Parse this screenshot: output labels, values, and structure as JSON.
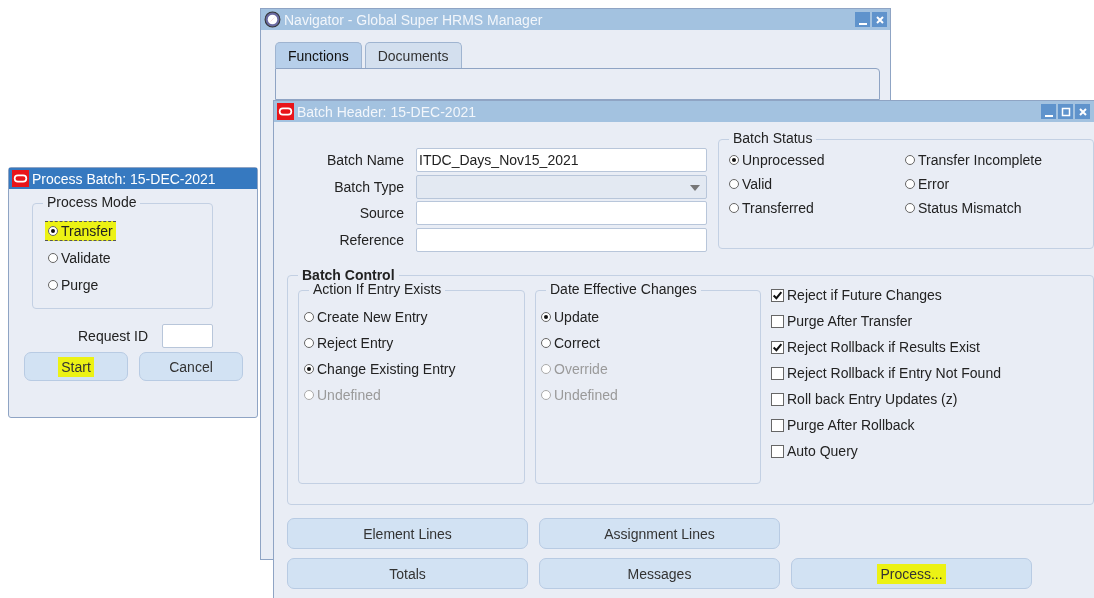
{
  "navigator": {
    "title": "Navigator - Global Super HRMS Manager",
    "tabs": [
      {
        "label": "Functions",
        "selected": true
      },
      {
        "label": "Documents",
        "selected": false
      }
    ]
  },
  "batch_header": {
    "title": "Batch Header: 15-DEC-2021",
    "fields": [
      {
        "label": "Batch Name",
        "kind": "text",
        "value": "ITDC_Days_Nov15_2021"
      },
      {
        "label": "Batch Type",
        "kind": "dropdown"
      },
      {
        "label": "Source",
        "kind": "text"
      },
      {
        "label": "Reference",
        "kind": "text"
      }
    ],
    "batch_status": {
      "label": "Batch Status",
      "options": [
        {
          "label": "Unprocessed",
          "selected": true
        },
        {
          "label": "Transfer Incomplete",
          "selected": false
        },
        {
          "label": "Valid",
          "selected": false
        },
        {
          "label": "Error",
          "selected": false
        },
        {
          "label": "Transferred",
          "selected": false
        },
        {
          "label": "Status Mismatch",
          "selected": false
        }
      ]
    },
    "batch_control": {
      "label": "Batch Control",
      "groups": [
        {
          "label": "Action If Entry Exists",
          "options": [
            {
              "label": "Create New Entry",
              "selected": false,
              "disabled": false
            },
            {
              "label": "Reject Entry",
              "selected": false,
              "disabled": false
            },
            {
              "label": "Change Existing Entry",
              "selected": true,
              "disabled": false
            },
            {
              "label": "Undefined",
              "selected": false,
              "disabled": true
            }
          ]
        },
        {
          "label": "Date Effective Changes",
          "options": [
            {
              "label": "Update",
              "selected": true,
              "disabled": false
            },
            {
              "label": "Correct",
              "selected": false,
              "disabled": false
            },
            {
              "label": "Override",
              "selected": false,
              "disabled": true
            },
            {
              "label": "Undefined",
              "selected": false,
              "disabled": true
            }
          ]
        }
      ],
      "checkboxes": [
        {
          "label": "Reject if Future Changes",
          "checked": true
        },
        {
          "label": "Purge After Transfer",
          "checked": false
        },
        {
          "label": "Reject Rollback if Results Exist",
          "checked": true
        },
        {
          "label": "Reject Rollback if Entry Not Found",
          "checked": false
        },
        {
          "label": "Roll back Entry Updates (z)",
          "checked": false
        },
        {
          "label": "Purge After Rollback",
          "checked": false
        },
        {
          "label": "Auto Query",
          "checked": false
        }
      ]
    },
    "button_rows": [
      [
        {
          "label": "Element Lines",
          "highlighted": false
        },
        {
          "label": "Assignment Lines",
          "highlighted": false
        }
      ],
      [
        {
          "label": "Totals",
          "highlighted": false
        },
        {
          "label": "Messages",
          "highlighted": false
        },
        {
          "label": "Process...",
          "highlighted": true
        }
      ]
    ]
  },
  "process_batch": {
    "title": "Process Batch: 15-DEC-2021",
    "process_mode": {
      "label": "Process Mode",
      "options": [
        {
          "label": "Transfer",
          "selected": true,
          "highlighted": true
        },
        {
          "label": "Validate",
          "selected": false,
          "highlighted": false
        },
        {
          "label": "Purge",
          "selected": false,
          "highlighted": false
        }
      ]
    },
    "request_id": {
      "label": "Request ID"
    },
    "buttons": [
      {
        "label": "Start",
        "highlighted": true
      },
      {
        "label": "Cancel",
        "highlighted": false
      }
    ]
  }
}
